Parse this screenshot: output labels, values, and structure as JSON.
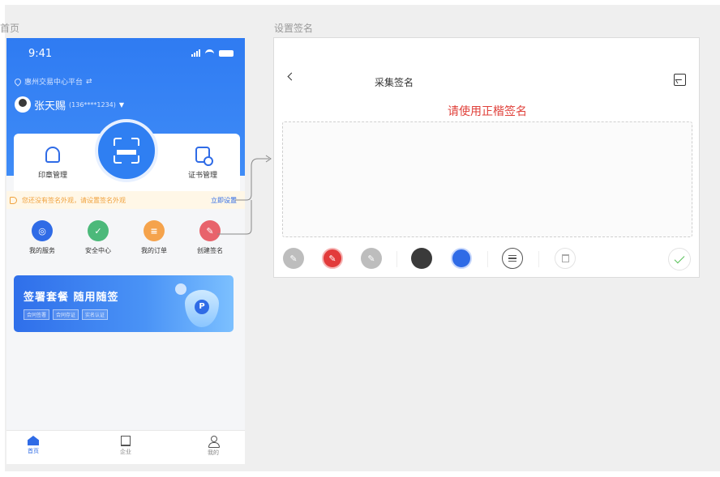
{
  "artboards": {
    "home_label": "首页",
    "sign_label": "设置签名"
  },
  "home": {
    "status_time": "9:41",
    "location": "惠州交易中心平台",
    "user_name": "张天赐",
    "user_phone": "(136****1234)",
    "functions": {
      "seal_label": "印章管理",
      "cert_label": "证书管理"
    },
    "notice": {
      "text": "您还没有签名外观，请设置签名外观",
      "link": "立即设置"
    },
    "services": [
      {
        "label": "我的服务",
        "color": "#2f6be6",
        "glyph": "◎"
      },
      {
        "label": "安全中心",
        "color": "#4cb97a",
        "glyph": "✓"
      },
      {
        "label": "我的订单",
        "color": "#f5a34c",
        "glyph": "≡"
      },
      {
        "label": "创建签名",
        "color": "#e8636b",
        "glyph": "✎"
      }
    ],
    "promo": {
      "title": "签署套餐 随用随签",
      "tags": [
        "合同签署",
        "合同存证",
        "实名认证"
      ],
      "coin": "P"
    },
    "tabs": [
      {
        "label": "首页",
        "icon": "home-icon"
      },
      {
        "label": "企业",
        "icon": "building-icon"
      },
      {
        "label": "我的",
        "icon": "person-icon"
      }
    ]
  },
  "sign": {
    "title": "采集签名",
    "hint": "请使用正楷签名",
    "pen_colors": [
      "#3a3a3a",
      "#2f6be6"
    ],
    "tools": [
      "pen-icon",
      "marker-icon",
      "brush-icon"
    ]
  },
  "colors": {
    "accent": "#2f6be6",
    "hint_red": "#e0403a",
    "notice": "#f0a13c",
    "confirm": "#59c25a"
  }
}
